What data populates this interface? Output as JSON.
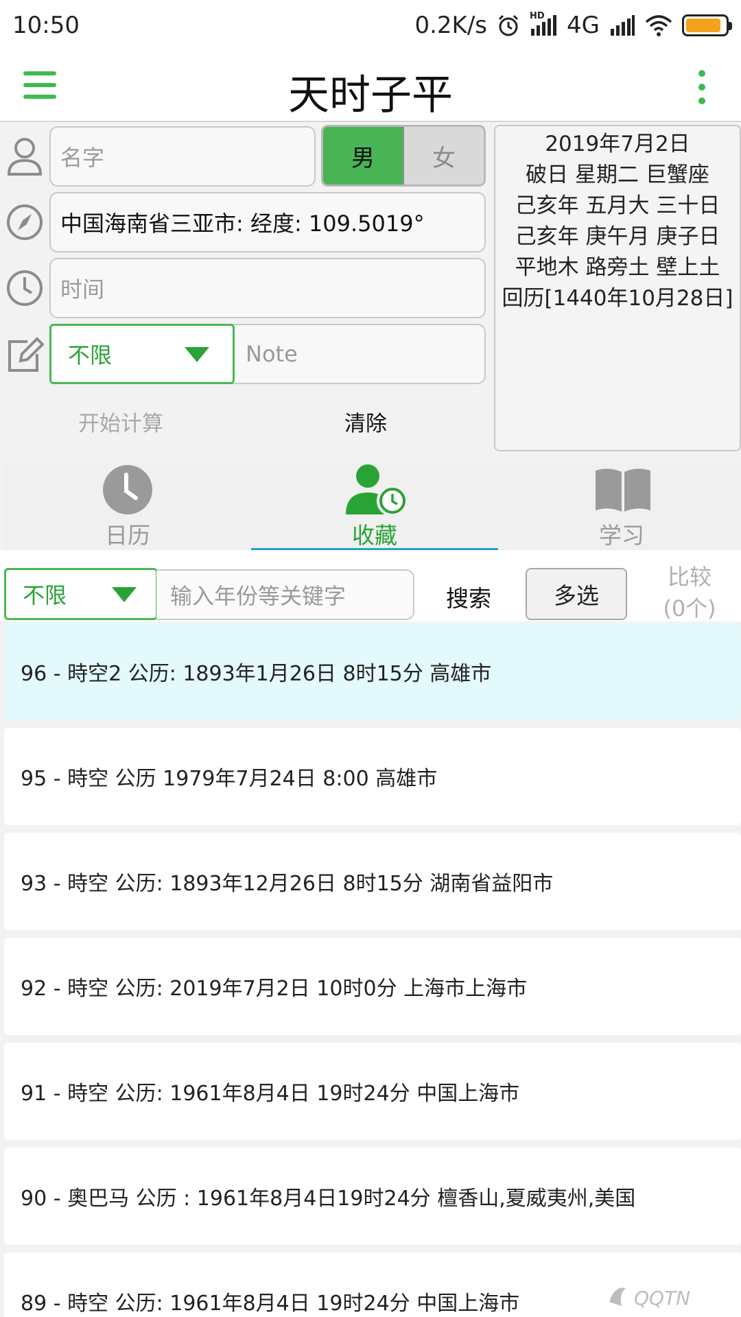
{
  "status_bar": {
    "time": "10:50",
    "net_speed": "0.2K/s",
    "network": "4G",
    "hd_label": "HD",
    "battery_level": 0.9,
    "battery_color": "#f3a31b"
  },
  "app_bar": {
    "title": "天时子平",
    "menu_icon": "hamburger-menu-icon",
    "more_icon": "more-vertical-icon",
    "accent_color": "#3fba4e"
  },
  "form": {
    "name_placeholder": "名字",
    "gender_male": "男",
    "gender_female": "女",
    "gender_selected": "男",
    "location_value": "中国海南省三亚市: 经度: 109.5019°",
    "time_placeholder": "时间",
    "category_select": "不限",
    "note_placeholder": "Note",
    "start_label": "开始计算",
    "clear_label": "清除"
  },
  "info_panel": {
    "lines": [
      "2019年7月2日",
      "破日 星期二 巨蟹座",
      "己亥年 五月大 三十日",
      "己亥年 庚午月 庚子日",
      "平地木 路旁土 壁上土",
      "回历[1440年10月28日]"
    ]
  },
  "tabs": [
    {
      "label": "日历",
      "icon": "clock-icon",
      "active": false
    },
    {
      "label": "收藏",
      "icon": "user-clock-icon",
      "active": true
    },
    {
      "label": "学习",
      "icon": "book-icon",
      "active": false
    }
  ],
  "search": {
    "filter_select": "不限",
    "keyword_placeholder": "输入年份等关键字",
    "search_label": "搜索",
    "multi_select_label": "多选",
    "compare_label_1": "比较",
    "compare_label_2": "(0个)"
  },
  "records": [
    "96 - 時空2 公历: 1893年1月26日 8时15分 高雄市",
    "95 - 時空 公历 1979年7月24日 8:00 高雄市",
    "93 - 時空 公历: 1893年12月26日 8时15分 湖南省益阳市",
    "92 - 時空 公历: 2019年7月2日 10时0分 上海市上海市",
    "91 - 時空 公历: 1961年8月4日 19时24分 中国上海市",
    "90 - 奧巴马 公历 : 1961年8月4日19时24分 檀香山,夏威夷州,美国",
    "89 - 時空 公历: 1961年8月4日 19时24分 中国上海市"
  ],
  "watermark": {
    "text": "QQTN"
  }
}
